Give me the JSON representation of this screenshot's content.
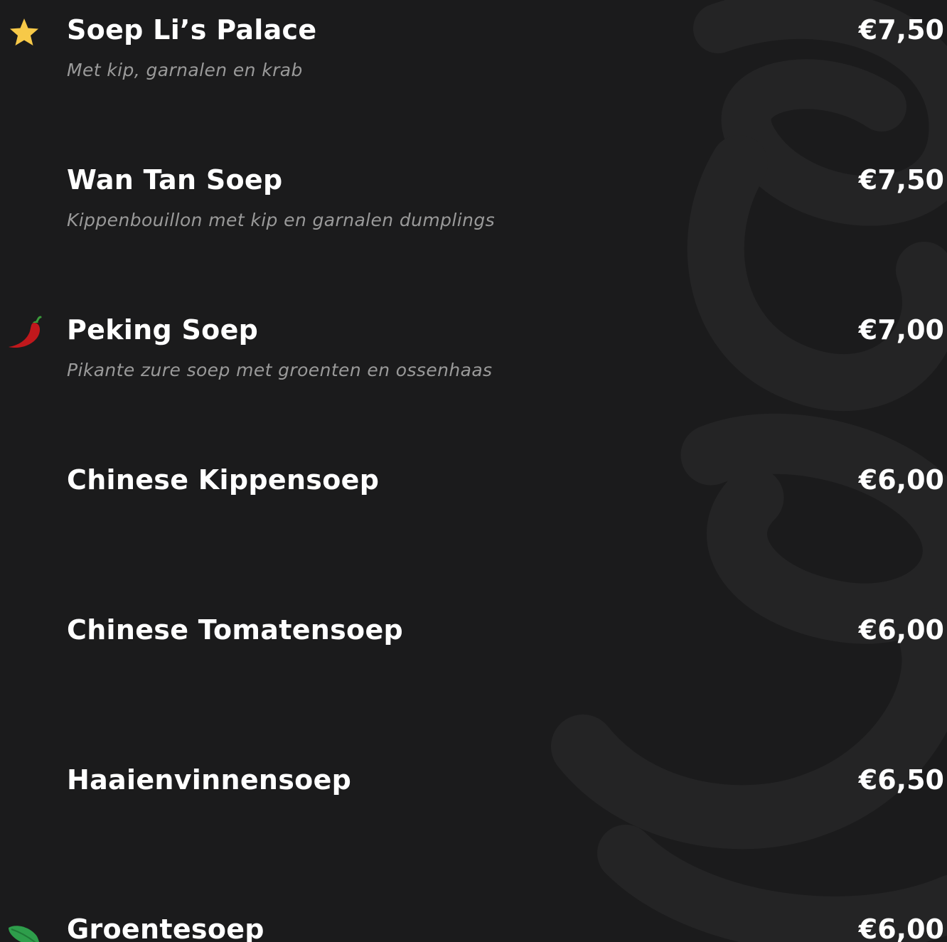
{
  "colors": {
    "background": "#1b1b1c",
    "watermark": "#252526",
    "title_text": "#ffffff",
    "description_text": "#9a9a9a",
    "star_icon": "#f7c948",
    "chili_icon": "#c0181c",
    "leaf_icon": "#2e9e4b"
  },
  "menu": {
    "items": [
      {
        "name": "Soep Li’s Palace",
        "description": "Met kip, garnalen en krab",
        "price": "€7,50",
        "icon": "star-icon"
      },
      {
        "name": "Wan Tan Soep",
        "description": "Kippenbouillon met kip en garnalen dumplings",
        "price": "€7,50",
        "icon": ""
      },
      {
        "name": "Peking Soep",
        "description": "Pikante zure soep met groenten en ossenhaas",
        "price": "€7,00",
        "icon": "chili-pepper-icon"
      },
      {
        "name": "Chinese Kippensoep",
        "description": "",
        "price": "€6,00",
        "icon": ""
      },
      {
        "name": "Chinese Tomatensoep",
        "description": "",
        "price": "€6,00",
        "icon": ""
      },
      {
        "name": "Haaienvinnensoep",
        "description": "",
        "price": "€6,50",
        "icon": ""
      },
      {
        "name": "Groentesoep",
        "description": "",
        "price": "€6,00",
        "icon": "leaf-icon"
      }
    ]
  }
}
